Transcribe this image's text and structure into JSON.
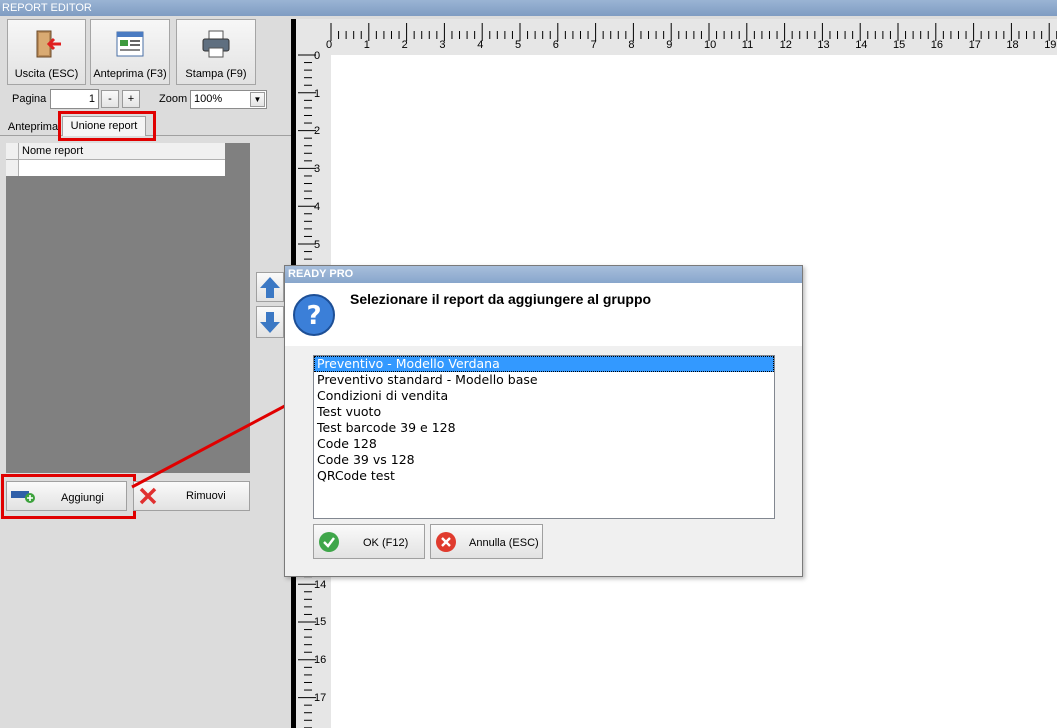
{
  "window": {
    "title": "REPORT EDITOR"
  },
  "toolbar": {
    "exit_label": "Uscita (ESC)",
    "preview_label": "Anteprima (F3)",
    "print_label": "Stampa (F9)",
    "page_label": "Pagina",
    "page_value": "1",
    "minus_label": "-",
    "plus_label": "+",
    "zoom_label": "Zoom",
    "zoom_value": "100%"
  },
  "tabs": [
    {
      "label": "Anteprima",
      "active": false
    },
    {
      "label": "Unione report",
      "active": true
    }
  ],
  "report_table": {
    "columns": [
      "Nome report"
    ],
    "rows": []
  },
  "buttons": {
    "add_label": "Aggiungi",
    "remove_label": "Rimuovi"
  },
  "ruler": {
    "horizontal": [
      "0",
      "1",
      "2",
      "3",
      "4",
      "5",
      "6",
      "7",
      "8",
      "9",
      "10",
      "11",
      "12",
      "13",
      "14",
      "15",
      "16",
      "17",
      "18",
      "19"
    ],
    "vertical": [
      "0",
      "1",
      "2",
      "3",
      "4",
      "5",
      "14",
      "15",
      "16",
      "17"
    ]
  },
  "dialog": {
    "title": "READY PRO",
    "question": "Selezionare il report da aggiungere al gruppo",
    "items": [
      "Preventivo - Modello Verdana",
      "Preventivo standard - Modello base",
      "Condizioni di vendita",
      "Test vuoto",
      "Test barcode 39 e 128",
      "Code 128",
      "Code 39 vs 128",
      "QRCode test"
    ],
    "selected_index": 0,
    "ok_label": "OK (F12)",
    "cancel_label": "Annulla (ESC)"
  },
  "colors": {
    "highlight": "#e00000",
    "selection": "#3399ff",
    "titlebar": "#88a6cc"
  }
}
